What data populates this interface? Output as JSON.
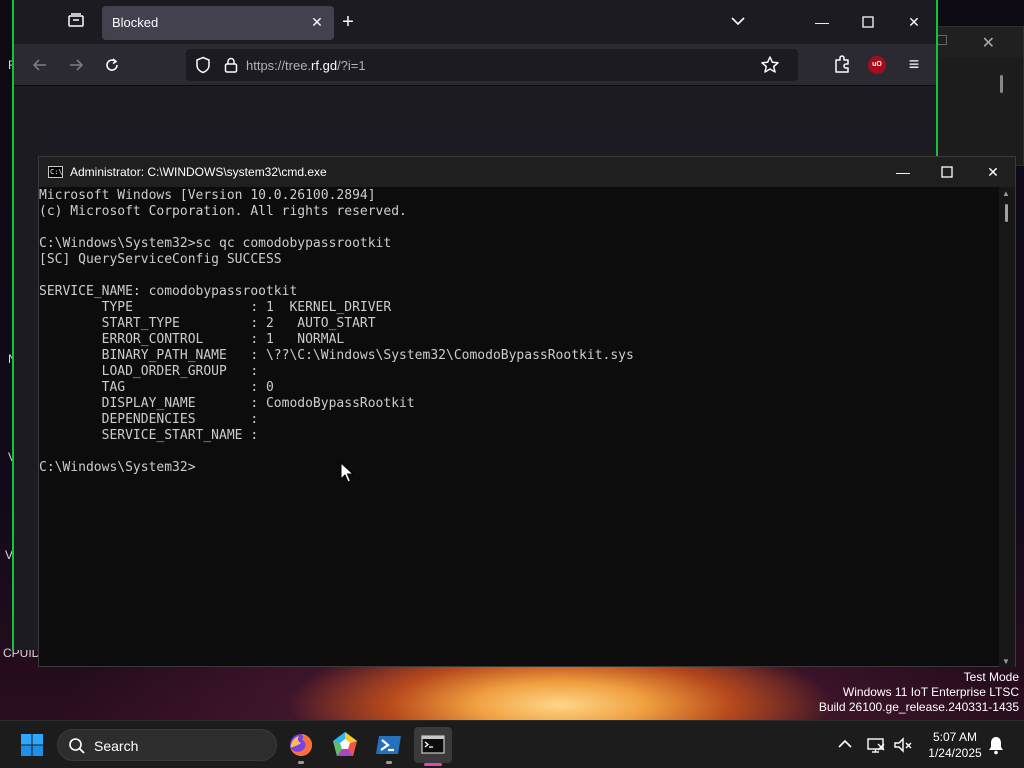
{
  "desktop": {
    "edge_letters": [
      "F",
      "N",
      "V",
      "V"
    ],
    "cpuid_label": "CPUID"
  },
  "firefox": {
    "tab_title": "Blocked",
    "url_prefix": "https://tree.",
    "url_host": "rf.gd",
    "url_suffix": "/?i=1",
    "icons": {
      "tab_list": "tab-list-icon",
      "new_tab": "plus-icon",
      "back": "arrow-left-icon",
      "forward": "arrow-right-icon",
      "reload": "reload-icon",
      "shield": "shield-icon",
      "lock": "lock-icon",
      "bookmark": "star-icon",
      "extensions": "puzzle-icon",
      "ublock": "ublock-icon",
      "menu": "hamburger-icon"
    },
    "ublock_label": "uO"
  },
  "cmd": {
    "title": "Administrator: C:\\WINDOWS\\system32\\cmd.exe",
    "lines": [
      "Microsoft Windows [Version 10.0.26100.2894]",
      "(c) Microsoft Corporation. All rights reserved.",
      "",
      "C:\\Windows\\System32>sc qc comodobypassrootkit",
      "[SC] QueryServiceConfig SUCCESS",
      "",
      "SERVICE_NAME: comodobypassrootkit",
      "        TYPE               : 1  KERNEL_DRIVER",
      "        START_TYPE         : 2   AUTO_START",
      "        ERROR_CONTROL      : 1   NORMAL",
      "        BINARY_PATH_NAME   : \\??\\C:\\Windows\\System32\\ComodoBypassRootkit.sys",
      "        LOAD_ORDER_GROUP   :",
      "        TAG                : 0",
      "        DISPLAY_NAME       : ComodoBypassRootkit",
      "        DEPENDENCIES       :",
      "        SERVICE_START_NAME :",
      "",
      "C:\\Windows\\System32>"
    ]
  },
  "watermark": {
    "line1": "Test Mode",
    "line2": "Windows 11 IoT Enterprise LTSC",
    "line3": "Build 26100.ge_release.240331-1435"
  },
  "taskbar": {
    "search_label": "Search",
    "apps": [
      "firefox-icon",
      "app-pentagon-icon",
      "powershell-icon",
      "terminal-icon"
    ],
    "time": "5:07 AM",
    "date": "1/24/2025"
  },
  "colors": {
    "firefox_border": "#13c43a",
    "cmd_bg": "#0c0c0c",
    "cmd_text": "#cccccc",
    "taskbar_bg": "#1c1c1c",
    "windows_blue": "#1e90ff"
  }
}
